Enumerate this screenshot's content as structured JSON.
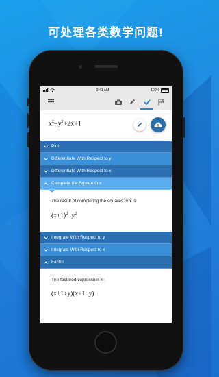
{
  "headline": "可处理各类数学问题!",
  "status_bar": {
    "time": "9:41 AM",
    "battery": "100%"
  },
  "toolbar": {
    "icons": [
      "menu-icon",
      "camera-icon",
      "pencil-icon",
      "checkmark-icon",
      "flag-icon"
    ],
    "active": "checkmark-icon"
  },
  "input_expression": {
    "x": "x",
    "x_exp": "2",
    "minus": "−y",
    "y_exp": "2",
    "rest": "+2x+1"
  },
  "sections": [
    {
      "label": "Plot",
      "state": "collapsed"
    },
    {
      "label": "Differentiate With Respect to y",
      "state": "collapsed"
    },
    {
      "label": "Differentiate With Respect to x",
      "state": "collapsed"
    },
    {
      "label": "Complete the Square in x",
      "state": "expanded",
      "description": "The result of completing the squares in x is:",
      "result": {
        "base": "(x+1)",
        "exp1": "2",
        "tail": "−y",
        "exp2": "2"
      }
    },
    {
      "label": "Integrate With Respect to y",
      "state": "collapsed"
    },
    {
      "label": "Integrate With Respect to x",
      "state": "collapsed"
    },
    {
      "label": "Factor",
      "state": "expanded",
      "description": "The factored expression is:",
      "result": {
        "text": "(x+1+y)(x+1−y)"
      }
    }
  ],
  "colors": {
    "accent": "#2f86c9",
    "section_blue": "#3a8fd6",
    "section_dark": "#2a6fb1",
    "section_expanded": "#5aaef0",
    "background": "#1f8be0"
  }
}
